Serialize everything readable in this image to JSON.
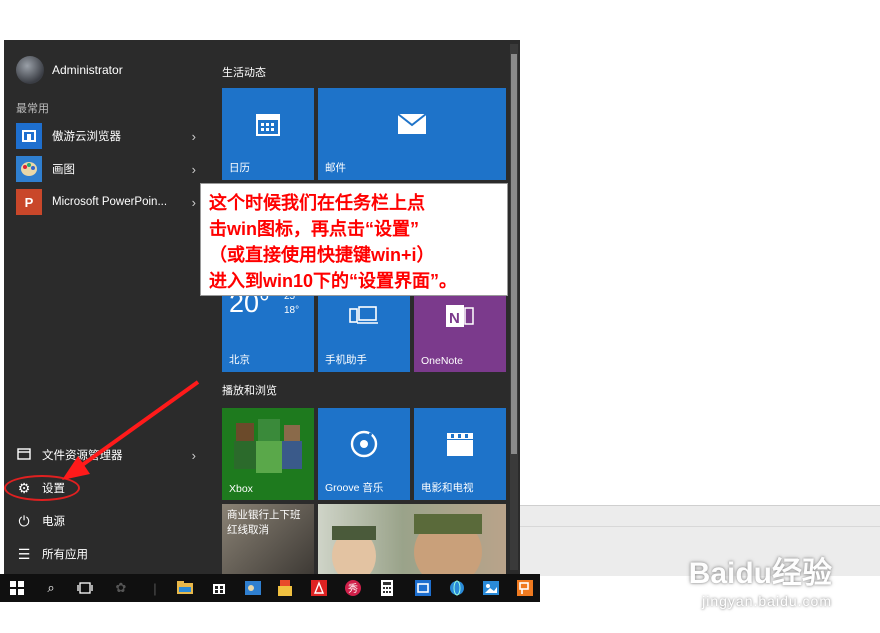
{
  "user": {
    "name": "Administrator"
  },
  "most_used_label": "最常用",
  "apps": [
    {
      "label": "傲游云浏览器",
      "icon": "maxthon-icon",
      "color": "#1e6fcf"
    },
    {
      "label": "画图",
      "icon": "paint-icon",
      "color": "#2f7fd0"
    },
    {
      "label": "Microsoft PowerPoin...",
      "icon": "powerpoint-icon",
      "color": "#c9472a"
    }
  ],
  "bottom": [
    {
      "label": "文件资源管理器",
      "icon": "file-explorer-icon"
    },
    {
      "label": "设置",
      "icon": "gear-icon"
    },
    {
      "label": "电源",
      "icon": "power-icon"
    },
    {
      "label": "所有应用",
      "icon": "all-apps-icon"
    }
  ],
  "groups": {
    "live": "生活动态",
    "play": "播放和浏览"
  },
  "tiles": {
    "calendar": "日历",
    "mail": "邮件",
    "weather_city": "北京",
    "weather_temp": "20°",
    "weather_high": "25°",
    "weather_low": "18°",
    "phone": "手机助手",
    "onenote": "OneNote",
    "xbox": "Xbox",
    "groove": "Groove 音乐",
    "movies": "电影和电视",
    "news_line1": "商业银行上下班",
    "news_line2": "红线取消"
  },
  "annotation": [
    "这个时候我们在任务栏上点",
    "击win图标，再点击“设置”",
    "（或直接使用快捷键win+i）",
    "进入到win10下的“设置界面”。"
  ],
  "watermark": {
    "brand": "Baidu经验",
    "url": "jingyan.baidu.com"
  },
  "colors": {
    "menu_bg": "#2b2b2b",
    "tile_blue": "#1e73c9",
    "tile_onenote": "#7b3a8c",
    "tile_xbox": "#1e7a1e",
    "annotation_red": "#ff0000"
  }
}
